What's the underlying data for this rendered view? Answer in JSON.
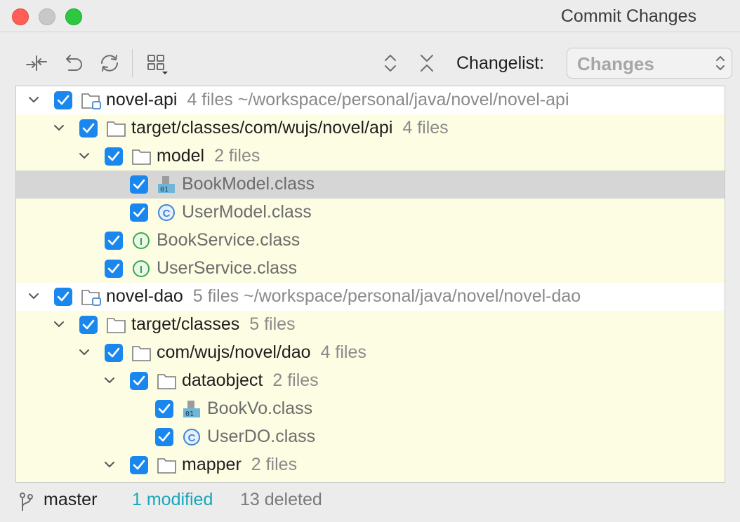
{
  "window": {
    "title": "Commit Changes"
  },
  "toolbar": {
    "icons": [
      "collapse-all-icon",
      "undo-icon",
      "refresh-icon",
      "group-by-icon",
      "expand-icon",
      "collapse-icon"
    ],
    "changelist_label": "Changelist:",
    "changelist_value": "Changes"
  },
  "tree": {
    "rows": [
      {
        "label": "novel-api",
        "count": "4 files  ~/workspace/personal/java/novel/novel-api",
        "type": "module",
        "arrow": "down"
      },
      {
        "label": "target/classes/com/wujs/novel/api",
        "count": "4 files",
        "type": "folder",
        "arrow": "down"
      },
      {
        "label": "model",
        "count": "2 files",
        "type": "folder",
        "arrow": "down"
      },
      {
        "label": "BookModel.class",
        "count": "",
        "type": "binary-class",
        "arrow": "",
        "selected": true
      },
      {
        "label": "UserModel.class",
        "count": "",
        "type": "class",
        "arrow": ""
      },
      {
        "label": "BookService.class",
        "count": "",
        "type": "interface",
        "arrow": ""
      },
      {
        "label": "UserService.class",
        "count": "",
        "type": "interface",
        "arrow": ""
      },
      {
        "label": "novel-dao",
        "count": "5 files  ~/workspace/personal/java/novel/novel-dao",
        "type": "module",
        "arrow": "down"
      },
      {
        "label": "target/classes",
        "count": "5 files",
        "type": "folder",
        "arrow": "down"
      },
      {
        "label": "com/wujs/novel/dao",
        "count": "4 files",
        "type": "folder",
        "arrow": "down"
      },
      {
        "label": "dataobject",
        "count": "2 files",
        "type": "folder",
        "arrow": "down"
      },
      {
        "label": "BookVo.class",
        "count": "",
        "type": "binary-class",
        "arrow": ""
      },
      {
        "label": "UserDO.class",
        "count": "",
        "type": "class",
        "arrow": ""
      },
      {
        "label": "mapper",
        "count": "2 files",
        "type": "folder",
        "arrow": "down"
      }
    ]
  },
  "status": {
    "branch": "master",
    "modified": "1 modified",
    "deleted": "13 deleted"
  },
  "colors": {
    "checkbox": "#1a87ee",
    "modified": "#1aa6b7",
    "changed_row_bg": "#fdfde3",
    "selected_row_bg": "#d6d6d6",
    "class_icon": "#3e86d6",
    "interface_icon": "#39a845"
  }
}
